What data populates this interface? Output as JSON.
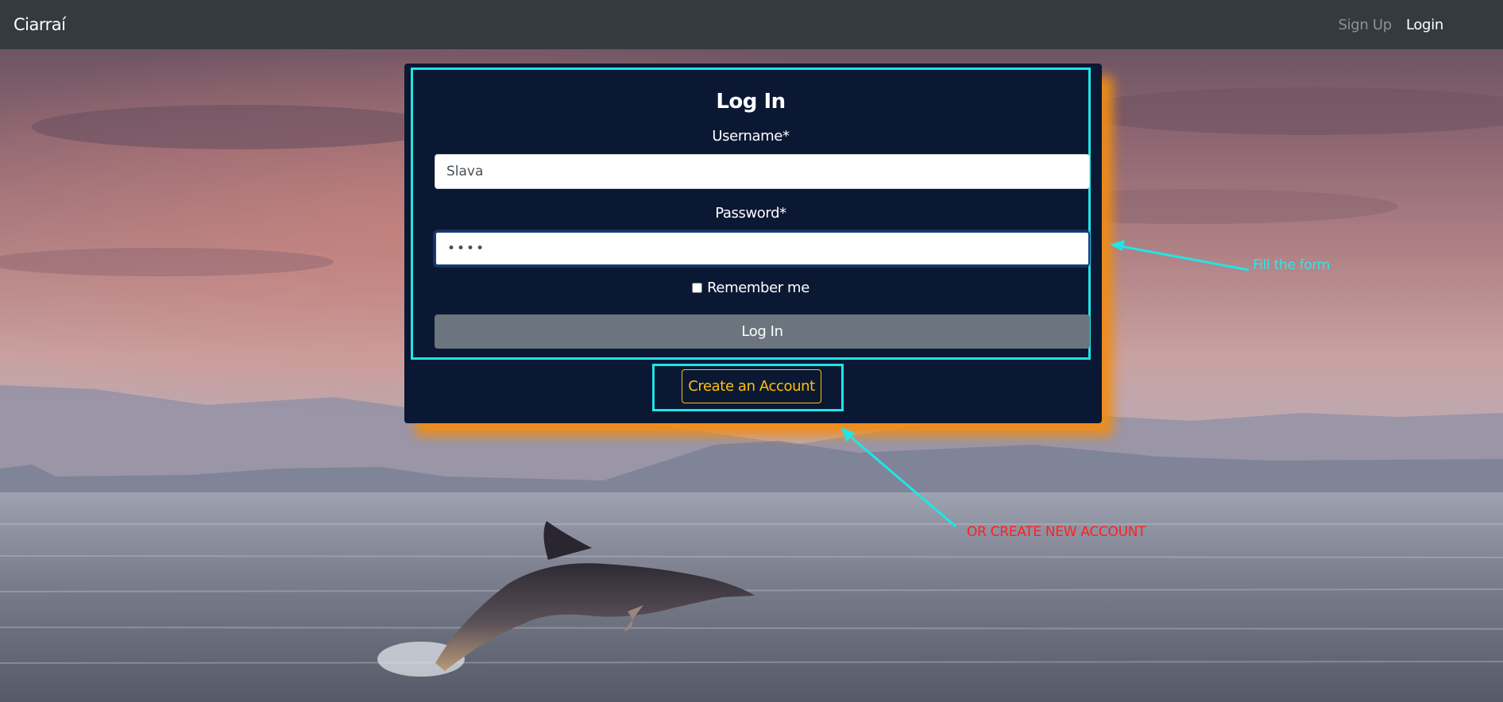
{
  "navbar": {
    "brand": "Ciarraí",
    "links": [
      {
        "label": "Sign Up"
      },
      {
        "label": "Login"
      }
    ]
  },
  "login_form": {
    "title": "Log In",
    "username_label": "Username*",
    "username_value": "Slava",
    "password_label": "Password*",
    "password_value": "••••",
    "remember_label": "Remember me",
    "remember_checked": false,
    "submit_label": "Log In"
  },
  "create_account": {
    "label": "Create an Account"
  },
  "annotations": {
    "fill_form": "Fill the form",
    "create_new": "OR CREATE NEW ACCOUNT"
  },
  "colors": {
    "navbar_bg": "#343a40",
    "card_bg": "#0b1833",
    "card_glow": "#f08c14",
    "annotation_cyan": "#1fe6e6",
    "annotation_red": "#ff2020",
    "button_gray": "#6c757d",
    "button_warning": "#ffc107"
  }
}
